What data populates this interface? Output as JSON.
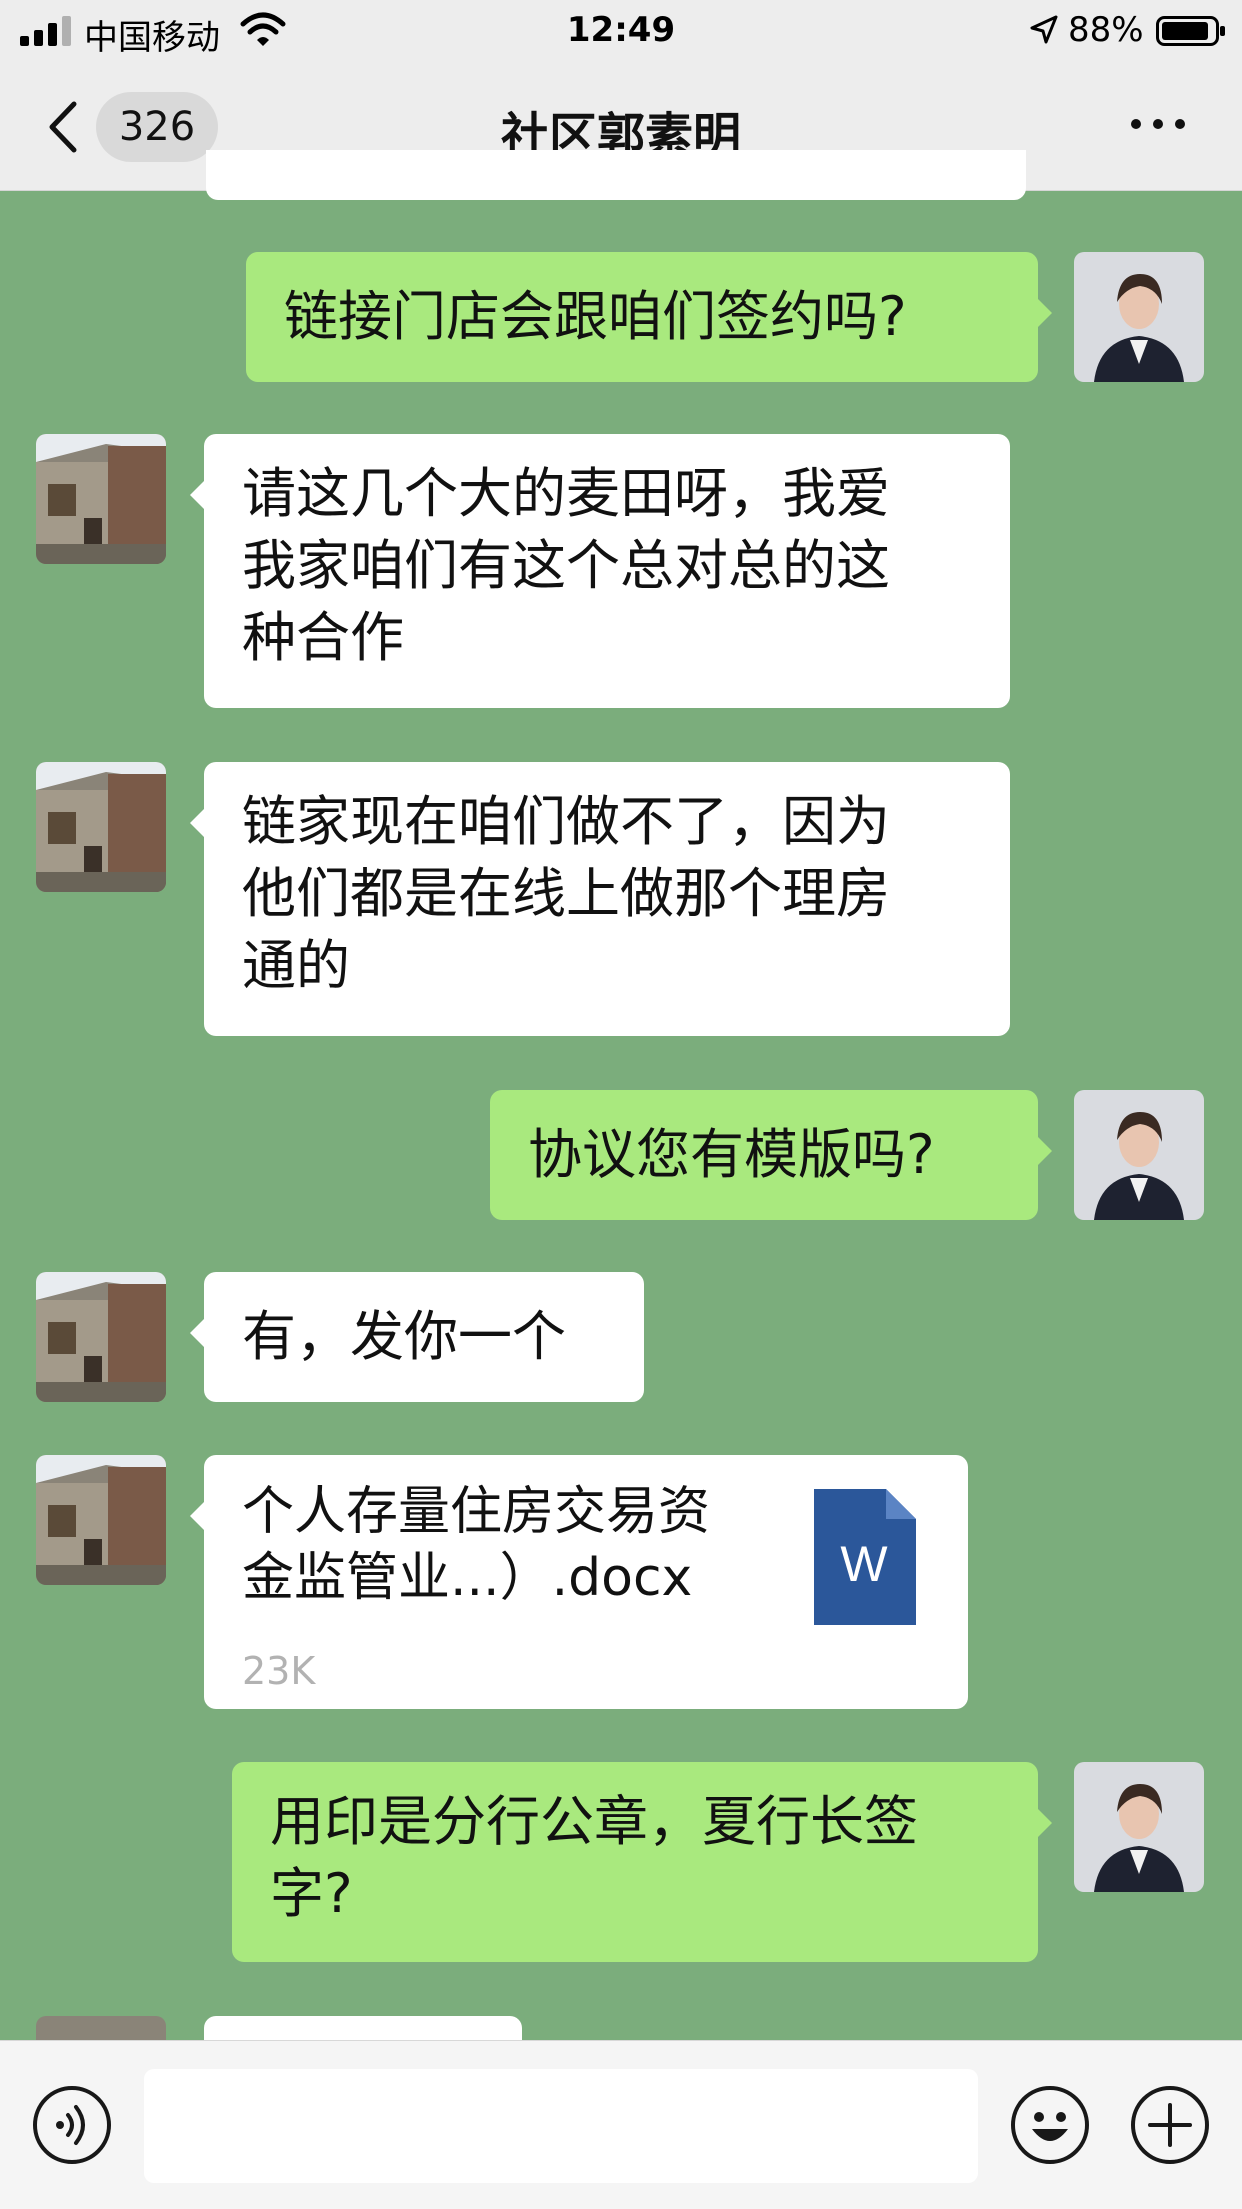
{
  "status_bar": {
    "carrier": "中国移动",
    "time": "12:49",
    "battery_percent": "88%",
    "icons": [
      "signal-icon",
      "wifi-icon",
      "location-arrow-icon",
      "battery-icon"
    ]
  },
  "header": {
    "unread_count": "326",
    "title": "社区郭素明",
    "icons": [
      "chevron-left-icon",
      "more-icon"
    ]
  },
  "messages": [
    {
      "side": "right",
      "type": "text",
      "text": "链接门店会跟咱们签约吗?"
    },
    {
      "side": "left",
      "type": "text",
      "text": "请这几个大的麦田呀，我爱\n我家咱们有这个总对总的这\n种合作"
    },
    {
      "side": "left",
      "type": "text",
      "text": "链家现在咱们做不了，因为\n他们都是在线上做那个理房\n通的"
    },
    {
      "side": "right",
      "type": "text",
      "text": "协议您有模版吗?"
    },
    {
      "side": "left",
      "type": "text",
      "text": "有，发你一个"
    },
    {
      "side": "left",
      "type": "file",
      "file_name": "个人存量住房交易资\n金监管业...）.docx",
      "file_size": "23K",
      "file_icon_letter": "W"
    },
    {
      "side": "right",
      "type": "text",
      "text": "用印是分行公章，夏行长签\n字?"
    }
  ],
  "input_bar": {
    "placeholder": "",
    "icons": [
      "voice-icon",
      "emoji-icon",
      "plus-icon"
    ]
  },
  "colors": {
    "chat_background": "#7bad7c",
    "outgoing_bubble": "#a9e97e",
    "incoming_bubble": "#ffffff",
    "word_icon": "#2b579a"
  }
}
